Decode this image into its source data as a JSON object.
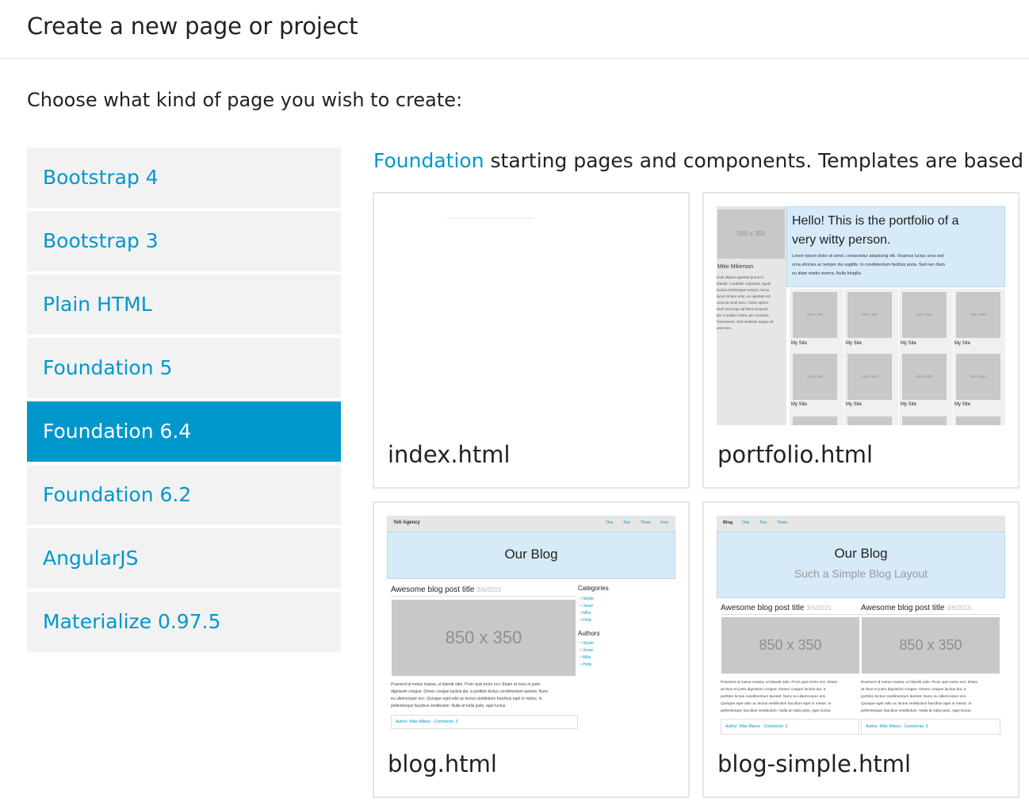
{
  "header": {
    "title": "Create a new page or project"
  },
  "prompt": "Choose what kind of page you wish to create:",
  "sidebar": {
    "items": [
      {
        "label": "Bootstrap 4"
      },
      {
        "label": "Bootstrap 3"
      },
      {
        "label": "Plain HTML"
      },
      {
        "label": "Foundation 5"
      },
      {
        "label": "Foundation 6.4",
        "active": true
      },
      {
        "label": "Foundation 6.2"
      },
      {
        "label": "AngularJS"
      },
      {
        "label": "Materialize 0.97.5"
      }
    ]
  },
  "intro": {
    "link": "Foundation",
    "text": " starting pages and components. Templates are based on"
  },
  "templates": [
    {
      "name": "index.html"
    },
    {
      "name": "portfolio.html"
    },
    {
      "name": "blog.html"
    },
    {
      "name": "blog-simple.html"
    }
  ],
  "portfolio_thumb": {
    "heading1": "Hello! This is the portfolio of a",
    "heading2": "very witty person.",
    "p1": "Lorem ipsum dolor sit amet, consectetur adipiscing elit. Vivamus luctus urna sed",
    "p2": "urna ultricies ac tempor dui sagittis. In condimentum facilisis porta. Sed nec diam",
    "p3": "eu diam mattis viverra. Nulla fringilla.",
    "avatar": "550 x 350",
    "name": "Mike Mikerson",
    "bio": [
      "Duis aliquet egestas purus in",
      "blandit. Curabitur vulputate, ligula",
      "lacinia scelerisque tempor, lacus",
      "lacus ornare ante, ac egestas est",
      "urna sit amet arcu. Class aptent",
      "taciti sociosqu ad litora torquent",
      "per conubia nostra, per inceptos",
      "himenaeos. Sed molestie augue sit",
      "amet leo."
    ],
    "tile": "550 x 550",
    "site": "My Site"
  },
  "blog_thumb": {
    "brand": "Yeti Agency",
    "nav": [
      "One",
      "Two",
      "Three",
      "Four"
    ],
    "title": "Our Blog",
    "post_title": "Awesome blog post title",
    "date": "3/6/2015",
    "image": "850 x 350",
    "categories_label": "Categories",
    "categories": [
      "Skyler",
      "Jesse",
      "Mike",
      "Holly"
    ],
    "authors_label": "Authors",
    "authors": [
      "Skyler",
      "Jesse",
      "Mike",
      "Holly"
    ],
    "body": [
      "Praesent id metus massa, ut blandit odio. Proin quis tortor orci. Etiam at risus et justo",
      "dignissim congue. Donec congue lacinia dui, a porttitor lectus condimentum laoreet. Nunc",
      "eu ullamcorper orci. Quisque eget odio ac lectus vestibulum faucibus eget in metus. In",
      "pellentesque faucibus vestibulum. Nulla at nulla justo, eget luctus."
    ],
    "footer": "Author: Mike Mikers · Comments: 3"
  },
  "blog_simple_thumb": {
    "brand": "Blog",
    "nav": [
      "One",
      "Two",
      "Three"
    ],
    "title": "Our Blog",
    "subtitle": "Such a Simple Blog Layout",
    "post_title": "Awesome blog post title",
    "date": "3/6/2015",
    "image": "850 x 350",
    "body": [
      "Praesent id metus massa, ut blandit odio. Proin quis tortor orci. Etiam",
      "at risus et justo dignissim congue. Donec congue lacinia dui, a",
      "porttitor lectus condimentum laoreet. Nunc eu ullamcorper orci.",
      "Quisque eget odio ac lectus vestibulum faucibus eget in metus. In",
      "pellentesque faucibus vestibulum. Nulla at nulla justo, eget luctus."
    ],
    "footer": "Author: Mike Mikers · Comments: 3"
  },
  "colors": {
    "accent": "#0097cc",
    "tile_bg": "#f2f2f2",
    "thumb_header": "#d6eaf8"
  }
}
